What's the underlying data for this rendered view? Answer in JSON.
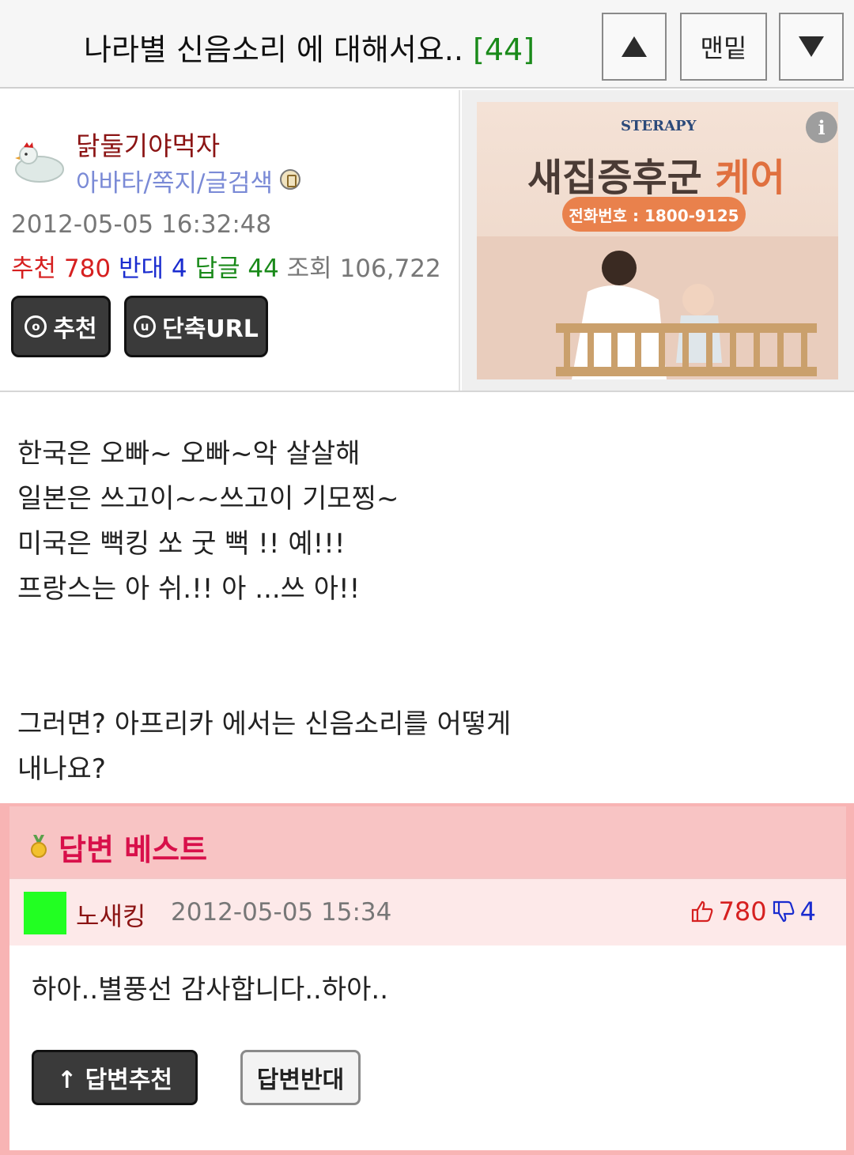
{
  "header": {
    "title": "나라별 신음소리 에 대해서요..",
    "reply_count": "[44]",
    "up_icon": "triangle-up-icon",
    "bottom_label": "맨밑",
    "down_icon": "triangle-down-icon"
  },
  "post_info": {
    "avatar_icon": "chicken-avatar-icon",
    "author": "닭둘기야먹자",
    "links": "아바타/쪽지/글검색",
    "badge_icon": "lock-badge-icon",
    "datetime": "2012-05-05 16:32:48",
    "stats": {
      "recommend_label": "추천",
      "recommend_value": "780",
      "oppose_label": "반대",
      "oppose_value": "4",
      "replies_label": "답글",
      "replies_value": "44",
      "views_label": "조회",
      "views_value": "106,722"
    },
    "recommend_button": "추천",
    "short_url_button": "단축URL"
  },
  "ad": {
    "brand": "STERAPY",
    "headline_main": "새집증후군",
    "headline_accent": "케어",
    "phone": "전화번호 : 1800-9125",
    "info_icon": "i"
  },
  "post_body": {
    "lines_top": [
      "한국은 오빠~ 오빠~악 살살해",
      "일본은 쓰고이~~쓰고이 기모찡~",
      "미국은 뻑킹 쏘 굿 뻑 !! 예!!!",
      "프랑스는 아 쉬.!! 아 ...쓰 아!!"
    ],
    "lines_bottom": [
      "그러면? 아프리카 에서는 신음소리를 어떻게",
      "내나요?"
    ]
  },
  "best_answer": {
    "title": "답변 베스트",
    "medal_icon": "medal-icon",
    "reply": {
      "author": "노새킹",
      "datetime": "2012-05-05 15:34",
      "upvotes": "780",
      "downvotes": "4",
      "text": "하아..별풍선 감사합니다..하아..",
      "upvote_button": "↑ 답변추천",
      "downvote_button": "답변반대"
    }
  },
  "colors": {
    "author_red": "#8b1414",
    "stat_red": "#d62020",
    "stat_blue": "#1a2ccf",
    "stat_green": "#1a8a1a",
    "best_pink": "#f8b4b4",
    "best_title": "#d8104a"
  }
}
